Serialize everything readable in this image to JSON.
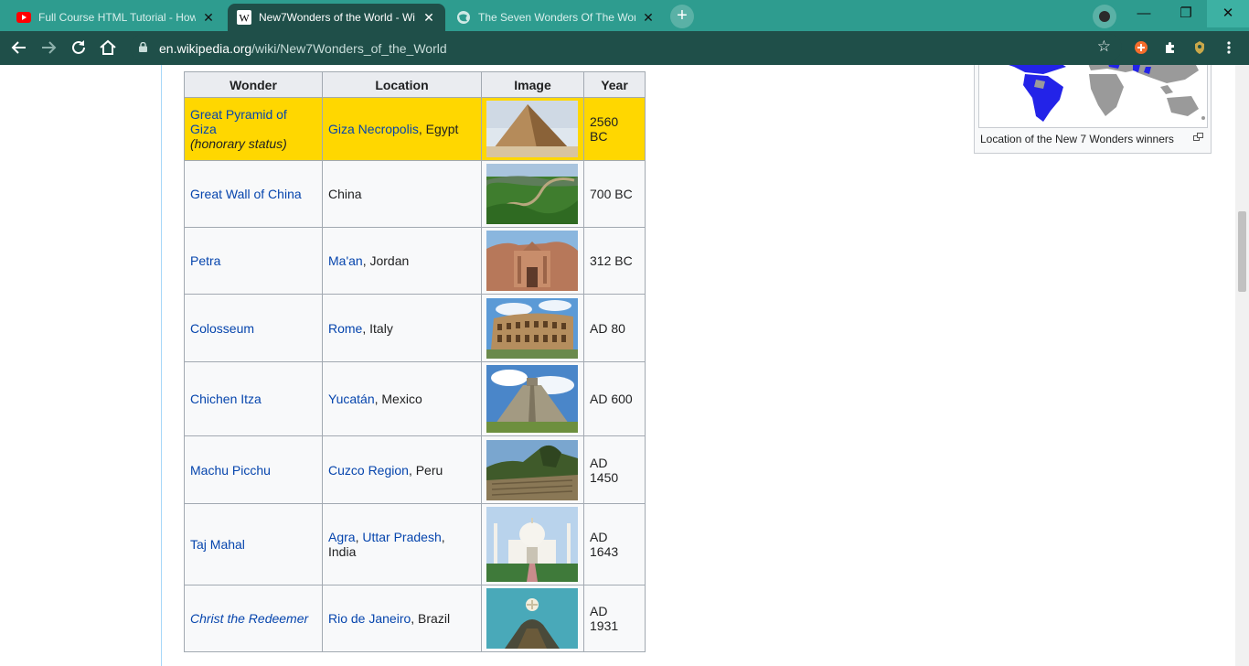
{
  "browser": {
    "tabs": [
      {
        "title": "Full Course HTML Tutorial - How",
        "favicon": "youtube-icon"
      },
      {
        "title": "New7Wonders of the World - Wi",
        "favicon": "wikipedia-icon"
      },
      {
        "title": "The Seven Wonders Of The Worl",
        "favicon": "globe-icon"
      }
    ],
    "active_tab_index": 1,
    "new_tab_symbol": "+",
    "close_symbol": "✕",
    "window_controls": {
      "minimize": "—",
      "restore": "❐",
      "close": "✕"
    },
    "url_host": "en.wikipedia.org",
    "url_path": "/wiki/New7Wonders_of_the_World",
    "accent_color": "#2e9c8f",
    "toolbar_color": "#1f4f49"
  },
  "table": {
    "headers": [
      "Wonder",
      "Location",
      "Image",
      "Year"
    ],
    "rows": [
      {
        "wonder": "Great Pyramid of Giza",
        "wonder_note": "(honorary status)",
        "loc_links": [
          "Giza Necropolis"
        ],
        "loc_text": ", Egypt",
        "image": "great-pyramid-photo",
        "year": "2560 BC",
        "highlight": true
      },
      {
        "wonder": "Great Wall of China",
        "loc_links": [],
        "loc_text": "China",
        "image": "great-wall-photo",
        "year": "700 BC"
      },
      {
        "wonder": "Petra",
        "loc_links": [
          "Ma'an"
        ],
        "loc_text": ", Jordan",
        "image": "petra-photo",
        "year": "312 BC"
      },
      {
        "wonder": "Colosseum",
        "loc_links": [
          "Rome"
        ],
        "loc_text": ", Italy",
        "image": "colosseum-photo",
        "year": "AD 80"
      },
      {
        "wonder": "Chichen Itza",
        "loc_links": [
          "Yucatán"
        ],
        "loc_text": ", Mexico",
        "image": "chichen-itza-photo",
        "year": "AD 600"
      },
      {
        "wonder": "Machu Picchu",
        "loc_links": [
          "Cuzco Region"
        ],
        "loc_text": ", Peru",
        "image": "machu-picchu-photo",
        "year": "AD 1450"
      },
      {
        "wonder": "Taj Mahal",
        "loc_links": [
          "Agra",
          "Uttar Pradesh"
        ],
        "loc_text": ", India",
        "image": "taj-mahal-photo",
        "year": "AD 1643"
      },
      {
        "wonder": "Christ the Redeemer",
        "wonder_italic": true,
        "loc_links": [
          "Rio de Janeiro"
        ],
        "loc_text": ", Brazil",
        "image": "christ-redeemer-photo",
        "year": "AD 1931"
      }
    ],
    "highlight_color": "#ffd700",
    "link_color": "#0645ad"
  },
  "map": {
    "caption": "Location of the New 7 Wonders winners",
    "image": "world-map-winners"
  }
}
